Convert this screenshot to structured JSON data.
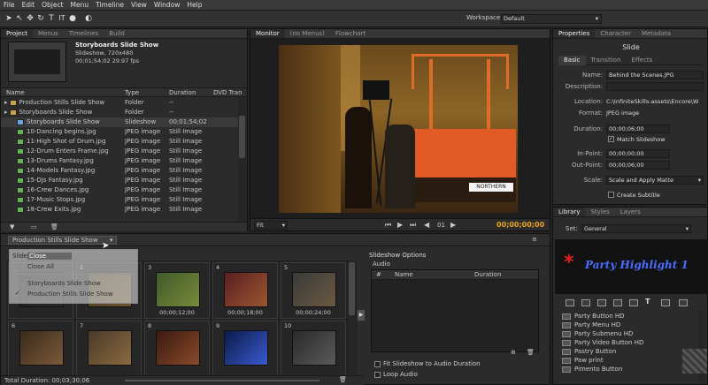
{
  "menubar": {
    "items": [
      "File",
      "Edit",
      "Object",
      "Menu",
      "Timeline",
      "View",
      "Window",
      "Help"
    ]
  },
  "toolbar": {
    "workspace_label": "Workspace:",
    "workspace_value": "Default",
    "tool_icons": [
      "select-icon",
      "direct-select-icon",
      "move-icon",
      "rotate-icon",
      "text-icon",
      "vertical-text-icon",
      "marker-icon",
      "preview-icon"
    ]
  },
  "project": {
    "tabs": [
      "Project",
      "Menus",
      "Timelines",
      "Build"
    ],
    "preview_title": "Storyboards Slide Show",
    "preview_info1": "Slideshow, 720x480",
    "preview_info2": "00;01;54;02 29.97 fps",
    "headers": [
      "Name",
      "Type",
      "Duration",
      "DVD Tran"
    ],
    "rows": [
      {
        "name": "Production Stills Slide Show",
        "type": "Folder",
        "duration": "--",
        "kind": "folder"
      },
      {
        "name": "Storyboards Slide Show",
        "type": "Folder",
        "duration": "--",
        "kind": "folder"
      },
      {
        "name": "Storyboards Slide Show",
        "type": "Slideshow",
        "duration": "00;01;54;02",
        "kind": "slideshow"
      },
      {
        "name": "10-Dancing begins.jpg",
        "type": "JPEG image",
        "duration": "Still Image",
        "kind": "image"
      },
      {
        "name": "11-High Shot of Drum.jpg",
        "type": "JPEG image",
        "duration": "Still Image",
        "kind": "image"
      },
      {
        "name": "12-Drum Enters Frame.jpg",
        "type": "JPEG image",
        "duration": "Still Image",
        "kind": "image"
      },
      {
        "name": "13-Drums Fantasy.jpg",
        "type": "JPEG image",
        "duration": "Still Image",
        "kind": "image"
      },
      {
        "name": "14-Models Fantasy.jpg",
        "type": "JPEG image",
        "duration": "Still Image",
        "kind": "image"
      },
      {
        "name": "15-DJs Fantasy.jpg",
        "type": "JPEG image",
        "duration": "Still Image",
        "kind": "image"
      },
      {
        "name": "16-Crew Dances.jpg",
        "type": "JPEG image",
        "duration": "Still Image",
        "kind": "image"
      },
      {
        "name": "17-Music Stops.jpg",
        "type": "JPEG image",
        "duration": "Still Image",
        "kind": "image"
      },
      {
        "name": "18-Crew Exits.jpg",
        "type": "JPEG image",
        "duration": "Still Image",
        "kind": "image"
      }
    ]
  },
  "monitor": {
    "tabs": [
      "Monitor",
      "(no Menus)",
      "Flowchart"
    ],
    "fit_value": "Fit",
    "frame_number": "01",
    "timecode": "00;00;00;00",
    "scene_sign": "NORTHERN"
  },
  "properties": {
    "tabs": [
      "Properties",
      "Character",
      "Metadata"
    ],
    "heading": "Slide",
    "subtabs": [
      "Basic",
      "Transition",
      "Effects"
    ],
    "name_label": "Name:",
    "name_value": "Behind the Scenes.JPG",
    "description_label": "Description:",
    "description_value": "",
    "location_label": "Location:",
    "location_value": "C:\\InfiniteSkills-assets\\Encore\\W",
    "format_label": "Format:",
    "format_value": "JPEG image",
    "duration_label": "Duration:",
    "duration_value": "00;00;06;00",
    "match_label": "Match Slideshow",
    "inpoint_label": "In-Point:",
    "inpoint_value": "00;00;00;00",
    "outpoint_label": "Out-Point:",
    "outpoint_value": "00;00;06;00",
    "scale_label": "Scale:",
    "scale_value": "Scale and Apply Matte",
    "subtitle_label": "Create Subtitle"
  },
  "library": {
    "tabs": [
      "Library",
      "Styles",
      "Layers"
    ],
    "set_label": "Set:",
    "set_value": "General",
    "preview_title": "Party Highlight 1",
    "items": [
      "Party Button HD",
      "Party Menu HD",
      "Party Submenu HD",
      "Party Video Button HD",
      "Pastry Button",
      "Paw print",
      "Pimento Button"
    ]
  },
  "slideshow": {
    "tab_label": "Production Stills Slide Show",
    "context_menu": {
      "items": [
        "Close",
        "Close All"
      ],
      "header_fragment": "Slide",
      "slideshows": [
        "Storyboards Slide Show",
        "Production Stills Slide Show"
      ],
      "checked_index": 1
    },
    "cells": [
      {
        "num": "",
        "time": ""
      },
      {
        "num": "2",
        "time": ""
      },
      {
        "num": "3",
        "time": "00;00;12;00"
      },
      {
        "num": "4",
        "time": "00;00;18;00"
      },
      {
        "num": "5",
        "time": "00;00;24;00"
      },
      {
        "num": "6",
        "time": ""
      },
      {
        "num": "7",
        "time": ""
      },
      {
        "num": "8",
        "time": ""
      },
      {
        "num": "9",
        "time": ""
      },
      {
        "num": "10",
        "time": ""
      }
    ],
    "total_duration": "Total Duration: 00;03;30;06",
    "options_title": "Slideshow Options",
    "audio_label": "Audio",
    "audio_headers": [
      "#",
      "Name",
      "Duration"
    ],
    "fit_label": "Fit Slideshow to Audio Duration",
    "loop_label": "Loop Audio"
  },
  "colors": {
    "accent": "#e8a320",
    "timecode": "#e8a320",
    "library_title": "#4a6cff",
    "star": "#e02020"
  }
}
